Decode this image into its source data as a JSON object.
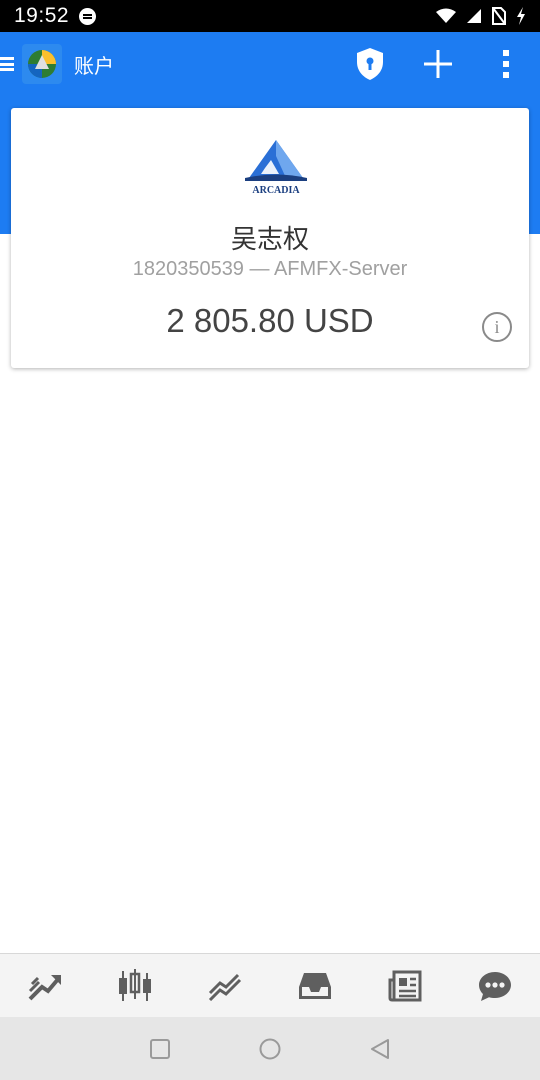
{
  "status_bar": {
    "time": "19:52",
    "icons": [
      "message-icon",
      "wifi-icon",
      "signal-icon",
      "no-sim-icon",
      "charging-icon"
    ]
  },
  "app_bar": {
    "title": "账户",
    "icons": [
      "menu-icon",
      "metatrader-logo",
      "shield-lock-icon",
      "add-icon",
      "more-vertical-icon"
    ],
    "color": "#1d7cf2"
  },
  "account_card": {
    "broker_logo_text": "ARCADIA",
    "name": "吴志权",
    "login_server": "1820350539 — AFMFX-Server",
    "balance": "2 805.80 USD",
    "info_icon": "info-icon"
  },
  "bottom_nav": {
    "items": [
      "quotes-icon",
      "chart-icon",
      "trade-icon",
      "history-icon",
      "news-icon",
      "chat-icon"
    ]
  },
  "system_nav": {
    "items": [
      "recents-icon",
      "home-icon",
      "back-icon"
    ]
  }
}
